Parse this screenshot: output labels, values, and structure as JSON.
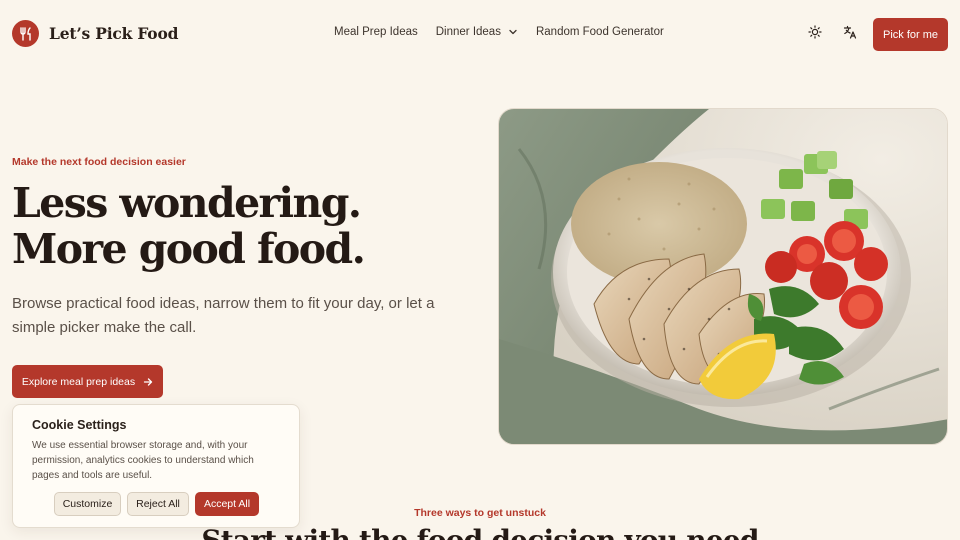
{
  "header": {
    "brand_name": "Let’s Pick Food",
    "nav": {
      "meal_prep": "Meal Prep Ideas",
      "dinner": "Dinner Ideas",
      "random": "Random Food Generator"
    },
    "cta_label": "Pick for me"
  },
  "hero": {
    "eyebrow": "Make the next food decision easier",
    "title_line1": "Less wondering.",
    "title_line2": "More good food.",
    "body": "Browse practical food ideas, narrow them to fit your day, or let a simple picker make the call.",
    "primary_button": "Explore meal prep ideas"
  },
  "cookie": {
    "title": "Cookie Settings",
    "body": "We use essential browser storage and, with your permission, analytics cookies to understand which pages and tools are useful.",
    "customize": "Customize",
    "reject": "Reject All",
    "accept": "Accept All"
  },
  "section": {
    "eyebrow": "Three ways to get unstuck",
    "title": "Start with the food decision you need"
  },
  "colors": {
    "accent": "#b4382b",
    "background": "#faf5ec"
  },
  "icons": {
    "logo": "fork-knife-icon",
    "theme": "sun-icon",
    "language": "translate-icon",
    "dropdown": "chevron-down-icon",
    "arrow": "arrow-right-icon"
  }
}
